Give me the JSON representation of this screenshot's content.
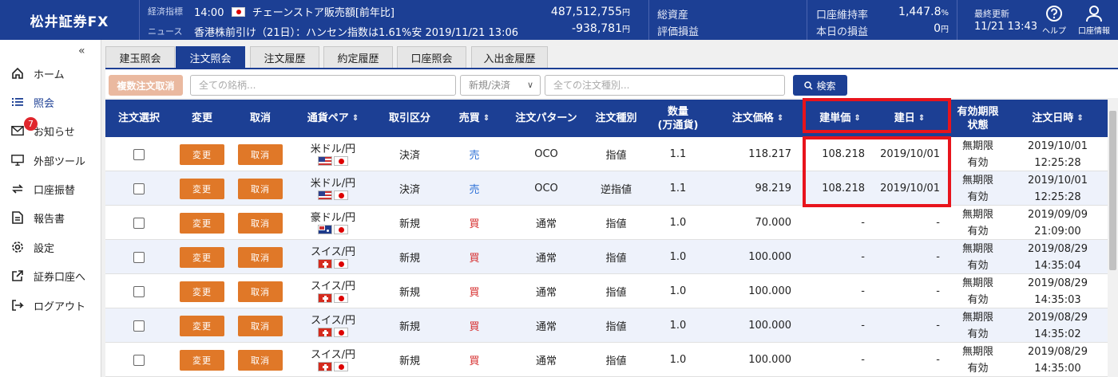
{
  "app": {
    "brand": "松井証券FX"
  },
  "ticker": {
    "indicator_label": "経済指標",
    "indicator_time": "14:00",
    "indicator_text": "チェーンストア販売額[前年比]",
    "news_label": "ニュース",
    "news_text": "香港株前引け（21日）：ハンセン指数は1.61%安 2019/11/21 13:06"
  },
  "summary": {
    "total_assets_label": "総資産",
    "total_assets_value": "487,512,755",
    "unrealized_label": "評価損益",
    "unrealized_value": "-938,781",
    "margin_rate_label": "口座維持率",
    "margin_rate_value": "1,447.8",
    "margin_rate_unit": "%",
    "daily_pl_label": "本日の損益",
    "daily_pl_value": "0",
    "yen_unit": "円",
    "last_update_label": "最終更新",
    "last_update_value": "11/21 13:43"
  },
  "header_icons": {
    "help_label": "ヘルプ",
    "account_label": "口座情報"
  },
  "sidebar": {
    "collapse_glyph": "«",
    "notification_count": "7",
    "items": [
      {
        "label": "ホーム",
        "icon": "home-icon"
      },
      {
        "label": "照会",
        "icon": "list-icon"
      },
      {
        "label": "お知らせ",
        "icon": "mail-icon"
      },
      {
        "label": "外部ツール",
        "icon": "monitor-icon"
      },
      {
        "label": "口座振替",
        "icon": "transfer-icon"
      },
      {
        "label": "報告書",
        "icon": "document-icon"
      },
      {
        "label": "設定",
        "icon": "gear-icon"
      },
      {
        "label": "証券口座へ",
        "icon": "external-link-icon"
      },
      {
        "label": "ログアウト",
        "icon": "logout-icon"
      }
    ]
  },
  "tabs": [
    "建玉照会",
    "注文照会",
    "注文履歴",
    "約定履歴",
    "口座照会",
    "入出金履歴"
  ],
  "filters": {
    "bulk_cancel_label": "複数注文取消",
    "symbol_placeholder": "全ての銘柄...",
    "type_select": "新規/決済",
    "order_type_placeholder": "全ての注文種別...",
    "search_label": "検索"
  },
  "table": {
    "headers": {
      "select": "注文選択",
      "modify": "変更",
      "cancel": "取消",
      "pair": "通貨ペア",
      "trade_type": "取引区分",
      "side": "売買",
      "pattern": "注文パターン",
      "order_kind": "注文種別",
      "qty_line1": "数量",
      "qty_line2": "(万通貨)",
      "price": "注文価格",
      "entry_price": "建単価",
      "entry_date": "建日",
      "expiry_line1": "有効期限",
      "expiry_line2": "状態",
      "order_dt": "注文日時"
    },
    "modify_label": "変更",
    "cancel_label": "取消",
    "rows": [
      {
        "pair": "米ドル/円",
        "flag": "us",
        "trade_type": "決済",
        "side": "売",
        "side_kind": "sell",
        "pattern": "OCO",
        "kind": "指値",
        "qty": "1.1",
        "price": "118.217",
        "entry_price": "108.218",
        "entry_date": "2019/10/01",
        "expiry": "無期限",
        "status": "有効",
        "date": "2019/10/01",
        "time": "12:25:28"
      },
      {
        "pair": "米ドル/円",
        "flag": "us",
        "trade_type": "決済",
        "side": "売",
        "side_kind": "sell",
        "pattern": "OCO",
        "kind": "逆指値",
        "qty": "1.1",
        "price": "98.219",
        "entry_price": "108.218",
        "entry_date": "2019/10/01",
        "expiry": "無期限",
        "status": "有効",
        "date": "2019/10/01",
        "time": "12:25:28"
      },
      {
        "pair": "豪ドル/円",
        "flag": "au",
        "trade_type": "新規",
        "side": "買",
        "side_kind": "buy",
        "pattern": "通常",
        "kind": "指値",
        "qty": "1.0",
        "price": "70.000",
        "entry_price": "-",
        "entry_date": "-",
        "expiry": "無期限",
        "status": "有効",
        "date": "2019/09/09",
        "time": "21:09:00"
      },
      {
        "pair": "スイス/円",
        "flag": "ch",
        "trade_type": "新規",
        "side": "買",
        "side_kind": "buy",
        "pattern": "通常",
        "kind": "指値",
        "qty": "1.0",
        "price": "100.000",
        "entry_price": "-",
        "entry_date": "-",
        "expiry": "無期限",
        "status": "有効",
        "date": "2019/08/29",
        "time": "14:35:04"
      },
      {
        "pair": "スイス/円",
        "flag": "ch",
        "trade_type": "新規",
        "side": "買",
        "side_kind": "buy",
        "pattern": "通常",
        "kind": "指値",
        "qty": "1.0",
        "price": "100.000",
        "entry_price": "-",
        "entry_date": "-",
        "expiry": "無期限",
        "status": "有効",
        "date": "2019/08/29",
        "time": "14:35:03"
      },
      {
        "pair": "スイス/円",
        "flag": "ch",
        "trade_type": "新規",
        "side": "買",
        "side_kind": "buy",
        "pattern": "通常",
        "kind": "指値",
        "qty": "1.0",
        "price": "100.000",
        "entry_price": "-",
        "entry_date": "-",
        "expiry": "無期限",
        "status": "有効",
        "date": "2019/08/29",
        "time": "14:35:02"
      },
      {
        "pair": "スイス/円",
        "flag": "ch",
        "trade_type": "新規",
        "side": "買",
        "side_kind": "buy",
        "pattern": "通常",
        "kind": "指値",
        "qty": "1.0",
        "price": "100.000",
        "entry_price": "-",
        "entry_date": "-",
        "expiry": "無期限",
        "status": "有効",
        "date": "2019/08/29",
        "time": "14:35:00"
      }
    ]
  },
  "colors": {
    "brand": "#1c3f94",
    "order_button": "#e07828",
    "sell": "#2b6fd6",
    "buy": "#d62b2b",
    "highlight": "#e8141c"
  }
}
